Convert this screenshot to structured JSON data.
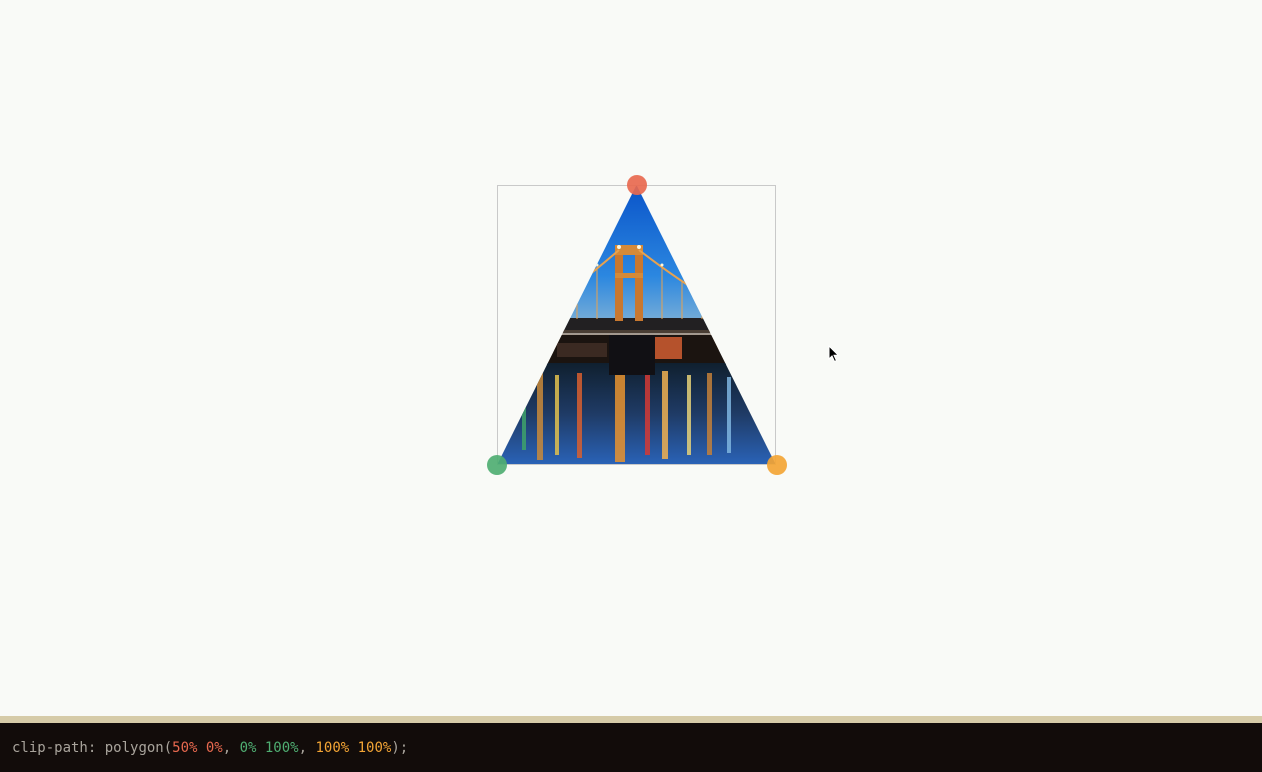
{
  "theme": {
    "page_bg": "#f9faf7",
    "frame_border": "#c9c9c9",
    "divider": "#d6cba8",
    "code_bg": "#120c0a",
    "code_text": "#a9a49c",
    "point_top": "#e8694f",
    "point_left": "#4fae72",
    "point_right": "#f3a535"
  },
  "photo": {
    "icon": "bridge-night-photo",
    "description_alt": "Bridge at night over a river"
  },
  "handles": [
    {
      "name": "top-vertex-handle",
      "color_key": "point_top"
    },
    {
      "name": "bottom-left-vertex-handle",
      "color_key": "point_left"
    },
    {
      "name": "bottom-right-vertex-handle",
      "color_key": "point_right"
    }
  ],
  "code": {
    "property": "clip-path:",
    "func_open": " polygon(",
    "p1": "50% 0%",
    "sep1": ", ",
    "p2": "0% 100%",
    "sep2": ", ",
    "p3": "100% 100%",
    "func_close": ");"
  }
}
